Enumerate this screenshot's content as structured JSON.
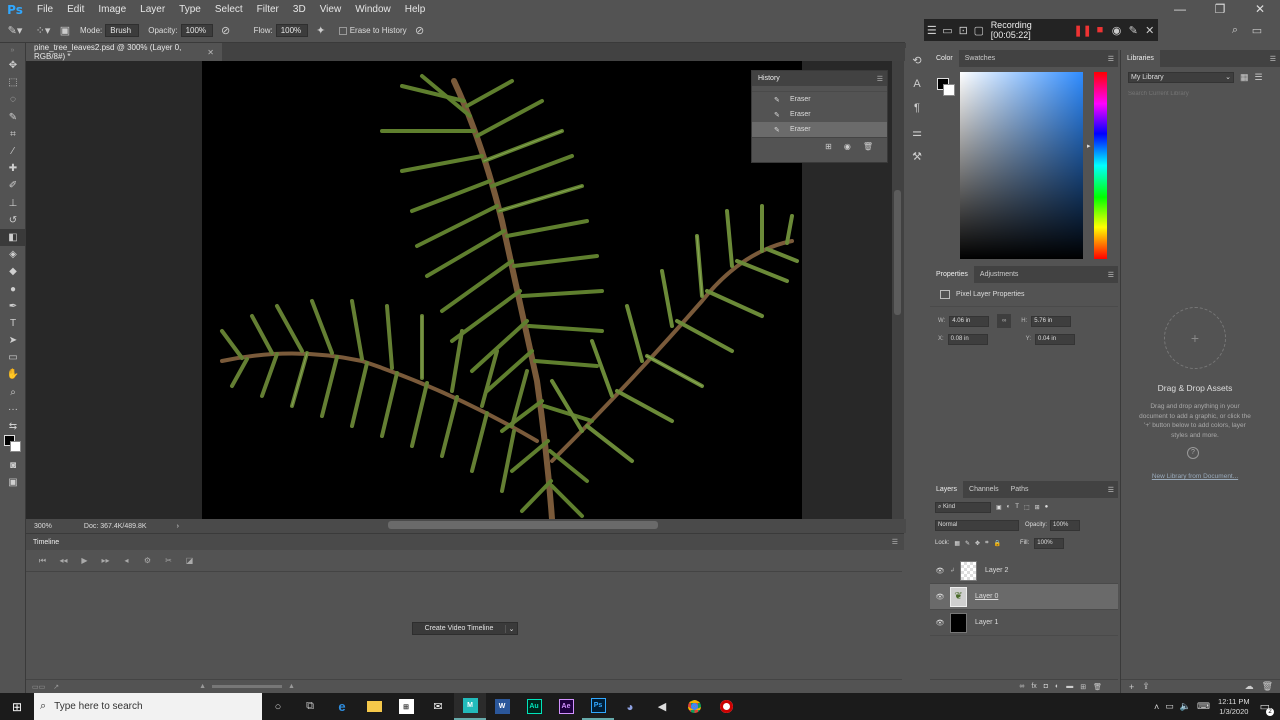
{
  "app": {
    "logo": "Ps",
    "window_controls": [
      "—",
      "❐",
      "✕"
    ]
  },
  "menu": [
    "File",
    "Edit",
    "Image",
    "Layer",
    "Type",
    "Select",
    "Filter",
    "3D",
    "View",
    "Window",
    "Help"
  ],
  "options": {
    "mode_label": "Mode:",
    "mode_value": "Brush",
    "opacity_label": "Opacity:",
    "opacity_value": "100%",
    "flow_label": "Flow:",
    "flow_value": "100%",
    "erase_history_label": "Erase to History"
  },
  "recording": {
    "text": "Recording [00:05:22]"
  },
  "document": {
    "tab_title": "pine_tree_leaves2.psd @ 300% (Layer 0, RGB/8#) *",
    "zoom": "300%",
    "doc_size": "Doc: 367.4K/489.8K"
  },
  "history": {
    "title": "History",
    "items": [
      {
        "label": "Eraser"
      },
      {
        "label": "Eraser"
      },
      {
        "label": "Eraser"
      }
    ]
  },
  "timeline": {
    "title": "Timeline",
    "create_button": "Create Video Timeline"
  },
  "color_panel": {
    "tabs": [
      "Color",
      "Swatches"
    ]
  },
  "properties": {
    "tabs": [
      "Properties",
      "Adjustments"
    ],
    "heading": "Pixel Layer Properties",
    "w_label": "W:",
    "w_value": "4.06 in",
    "h_label": "H:",
    "h_value": "5.76 in",
    "x_label": "X:",
    "x_value": "0.08 in",
    "y_label": "Y:",
    "y_value": "0.04 in"
  },
  "layers": {
    "tabs": [
      "Layers",
      "Channels",
      "Paths"
    ],
    "kind_label": "Kind",
    "blend_mode": "Normal",
    "opacity_label": "Opacity:",
    "opacity_value": "100%",
    "lock_label": "Lock:",
    "fill_label": "Fill:",
    "fill_value": "100%",
    "items": [
      {
        "name": "Layer 2"
      },
      {
        "name": "Layer 0"
      },
      {
        "name": "Layer 1"
      }
    ]
  },
  "libraries": {
    "title": "Libraries",
    "selected": "My Library",
    "search_placeholder": "Search Current Library",
    "drag_title": "Drag & Drop Assets",
    "drag_desc": "Drag and drop anything in your document to add a graphic, or click the '+' button below to add colors, layer styles and more.",
    "new_link": "New Library from Document..."
  },
  "taskbar": {
    "search_placeholder": "Type here to search",
    "time": "12:11 PM",
    "date": "1/3/2020",
    "notification_count": "2"
  },
  "colors": {
    "accent": "#31a8ff",
    "record": "#e33333"
  }
}
